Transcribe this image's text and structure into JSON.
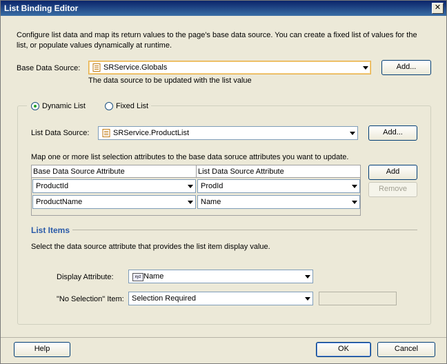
{
  "window": {
    "title": "List Binding Editor"
  },
  "intro": {
    "line1": "Configure list data and map its return values to the page's base data source. You can create a fixed list of values for the",
    "line2": "list, or populate values dynamically at runtime."
  },
  "base": {
    "label": "Base Data Source:",
    "value": "SRService.Globals",
    "add_label": "Add...",
    "hint": "The data source to be updated with the list value"
  },
  "mode": {
    "dynamic_label": "Dynamic List",
    "fixed_label": "Fixed List",
    "selected": "dynamic"
  },
  "list_source": {
    "label": "List Data Source:",
    "value": "SRService.ProductList",
    "add_label": "Add..."
  },
  "mapping": {
    "instruction": "Map one or more list selection attributes to the base data soruce attributes you want to update.",
    "columns": [
      "Base Data Source Attribute",
      "List Data Source Attribute"
    ],
    "rows": [
      {
        "base": "ProductId",
        "list": "ProdId"
      },
      {
        "base": "ProductName",
        "list": "Name"
      }
    ],
    "add_label": "Add",
    "remove_label": "Remove"
  },
  "list_items": {
    "heading": "List Items",
    "instruction": "Select the data source attribute that provides the list item display value.",
    "display_label": "Display Attribute:",
    "display_value": "Name",
    "display_icon_text": "xyz",
    "nosel_label": "\"No Selection\" Item:",
    "nosel_value": "Selection Required"
  },
  "footer": {
    "help_label": "Help",
    "ok_label": "OK",
    "cancel_label": "Cancel"
  },
  "colors": {
    "heading": "#2a5aa8",
    "title_bar": "#0a246a"
  }
}
